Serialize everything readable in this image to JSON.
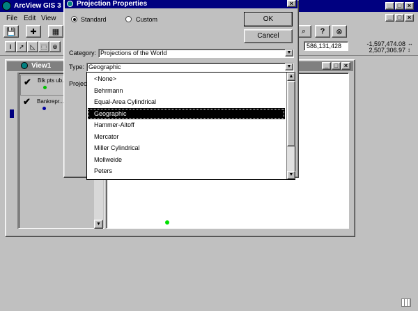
{
  "app": {
    "title": "ArcView GIS 3",
    "menu": [
      "File",
      "Edit",
      "View"
    ],
    "coord_x": "586,131,428",
    "coord_x_label": "-1,597,474.08",
    "coord_y_label": "2,507,306.97"
  },
  "view": {
    "title": "View1",
    "layers": [
      {
        "name": "Blk pts ub...",
        "checked": true,
        "dot_color": "#00c000"
      },
      {
        "name": "Bankrepr...",
        "checked": true,
        "dot_color": "#0000a0"
      }
    ],
    "map_point_color": "#00e000"
  },
  "dialog": {
    "title": "Projection Properties",
    "standard_label": "Standard",
    "custom_label": "Custom",
    "ok_label": "OK",
    "cancel_label": "Cancel",
    "category_label": "Category:",
    "category_value": "Projections of the World",
    "type_label": "Type:",
    "type_value": "Geographic",
    "projection_label": "Projec",
    "type_options": [
      "<None>",
      "Behrmann",
      "Equal-Area Cylindrical",
      "Geographic",
      "Hammer-Aitoff",
      "Mercator",
      "Miller Cylindrical",
      "Mollweide",
      "Peters"
    ],
    "selected_index": 3
  },
  "colors": {
    "title_active": "#000080",
    "face": "#c0c0c0",
    "highlight": "#000080"
  }
}
